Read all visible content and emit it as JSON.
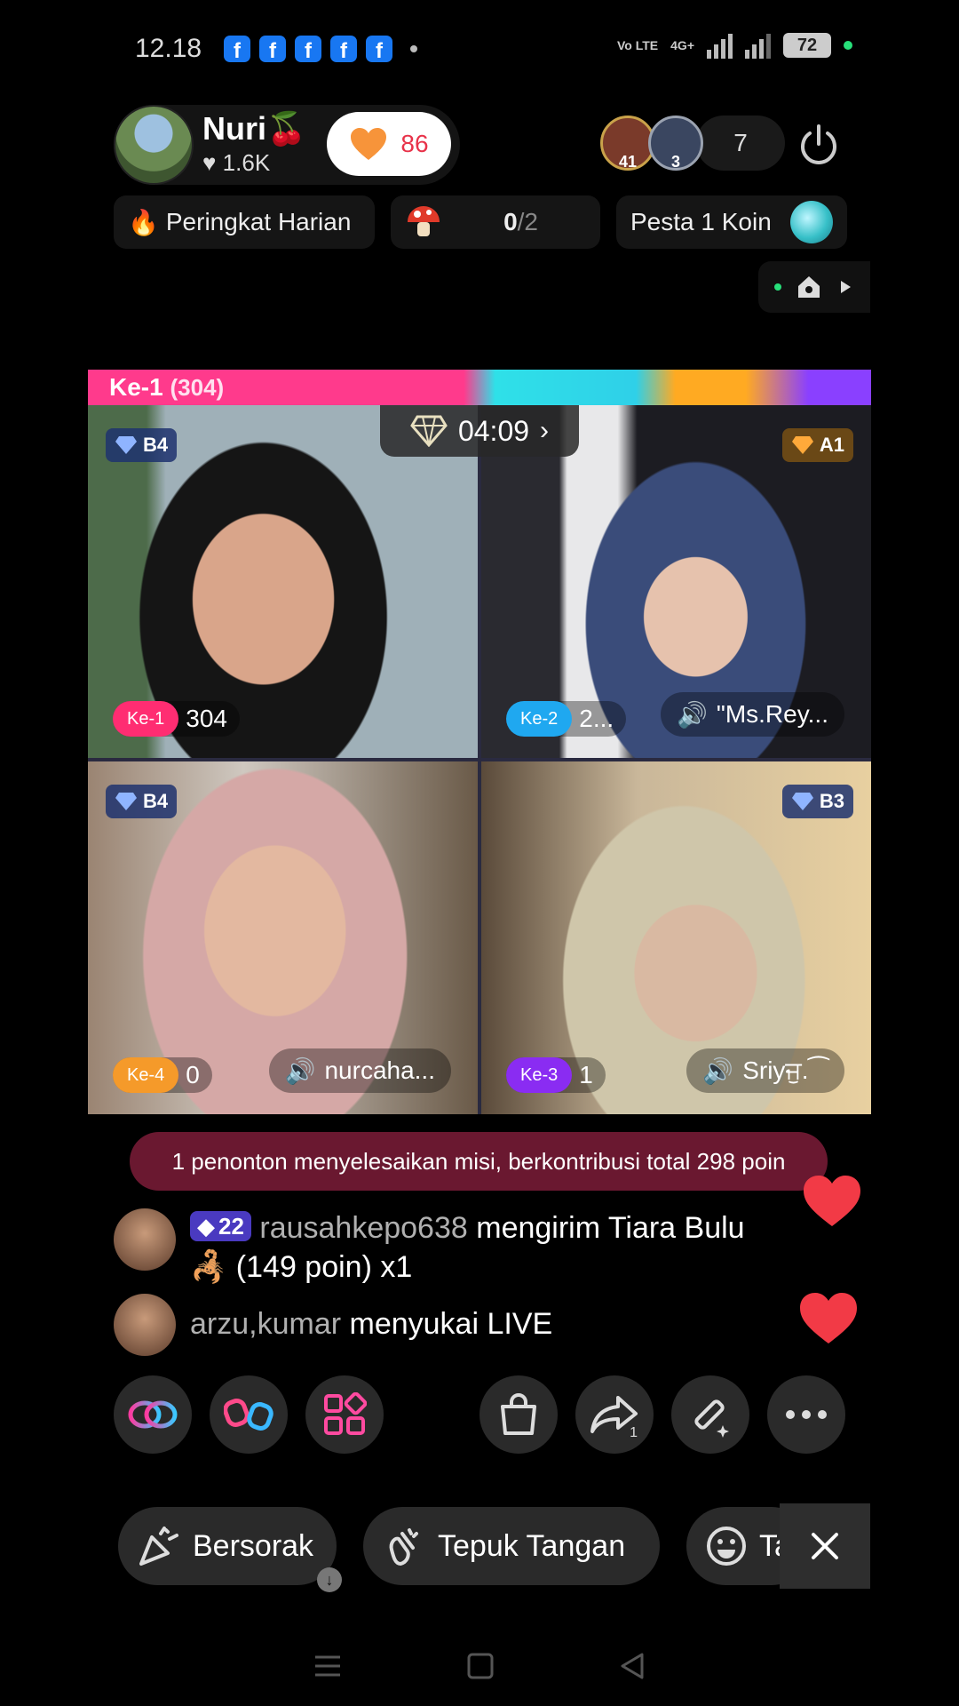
{
  "status_bar": {
    "time": "12.18",
    "volte": "Vo LTE",
    "network": "4G+",
    "battery": "72"
  },
  "host": {
    "name": "Nuri🍒",
    "likes": "1.6K",
    "follow_count": "86"
  },
  "viewers": {
    "badge1": "41",
    "badge2": "3",
    "count": "7"
  },
  "chips": {
    "ranking": "Peringkat Harian",
    "mission_progress": "0",
    "mission_total": "/2",
    "party": "Pesta 1 Koin"
  },
  "banner": {
    "rank": "Ke-1",
    "score": "(304)"
  },
  "timer": "04:09",
  "tiles": [
    {
      "rank_badge": "B4",
      "position": "Ke-1",
      "score": "304",
      "voice": ""
    },
    {
      "rank_badge": "A1",
      "position": "Ke-2",
      "score": "2...",
      "voice": "\"Ms.Rey..."
    },
    {
      "rank_badge": "B4",
      "position": "Ke-4",
      "score": "0",
      "voice": "nurcaha..."
    },
    {
      "rank_badge": "B3",
      "position": "Ke-3",
      "score": "1",
      "voice": "Sriyਜੁ.⁀"
    }
  ],
  "mission_banner": "1 penonton menyelesaikan misi, berkontribusi total 298 poin",
  "comments": [
    {
      "level": "22",
      "user": "rausahkepo638",
      "text": " mengirim Tiara Bulu",
      "line2": "(149 poin) x1"
    },
    {
      "user": "arzu,kumar",
      "text": " menyukai LIVE"
    }
  ],
  "quick_bar": {
    "cheer": "Bersorak",
    "clap": "Tepuk Tangan",
    "third": "Ta"
  },
  "share_count": "1"
}
